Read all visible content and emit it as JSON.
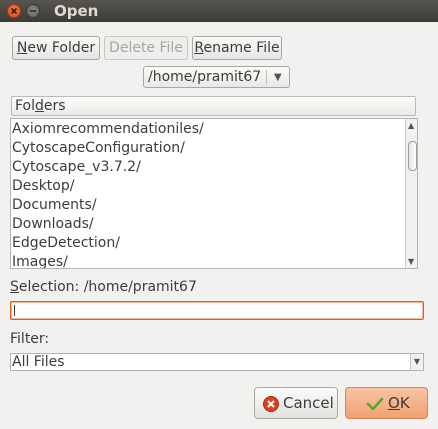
{
  "window": {
    "title": "Open"
  },
  "toolbar": {
    "new_folder": {
      "prefix": "",
      "ul": "N",
      "rest": "ew Folder"
    },
    "delete_file": {
      "prefix": "Delete File",
      "ul": "",
      "rest": ""
    },
    "rename_file": {
      "prefix": "",
      "ul": "R",
      "rest": "ename File"
    }
  },
  "path_combo": {
    "value": "/home/pramit67"
  },
  "folders": {
    "header_prefix": "Fol",
    "header_ul": "d",
    "header_rest": "ers",
    "items": [
      "Axiomrecommendationiles/",
      "CytoscapeConfiguration/",
      "Cytoscape_v3.7.2/",
      "Desktop/",
      "Documents/",
      "Downloads/",
      "EdgeDetection/",
      "Images/"
    ]
  },
  "selection": {
    "label_ul": "S",
    "label_rest": "election: /home/pramit67",
    "value": ""
  },
  "filter": {
    "label": "Filter:",
    "value": "All Files"
  },
  "buttons": {
    "cancel": "Cancel",
    "ok_ul": "O",
    "ok_rest": "K"
  },
  "colors": {
    "titlebar": "#3c3b37",
    "close_button": "#df4a16",
    "ok_accent": "#f0a174",
    "focus_border": "#e05d1f"
  }
}
